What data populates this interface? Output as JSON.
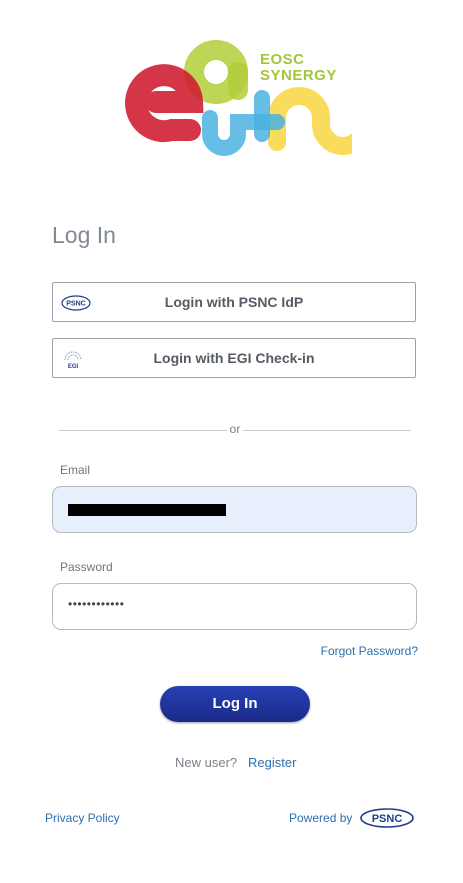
{
  "brand": {
    "line1": "EOSC",
    "line2": "SYNERGY"
  },
  "login": {
    "title": "Log In",
    "idp_buttons": [
      {
        "label": "Login with PSNC IdP",
        "icon": "psnc-icon",
        "icon_text": "PSNC"
      },
      {
        "label": "Login with EGI Check-in",
        "icon": "egi-icon",
        "icon_text": "EGI"
      }
    ],
    "divider_text": "or",
    "email_label": "Email",
    "password_label": "Password",
    "password_value": "••••••••••••",
    "forgot_password": "Forgot Password?",
    "submit_label": "Log In",
    "new_user_text": "New user?",
    "register_link": "Register"
  },
  "footer": {
    "privacy_policy": "Privacy Policy",
    "powered_by": "Powered by",
    "psnc_logo_text": "PSNC"
  },
  "colors": {
    "red": "#cf2034",
    "green": "#b3cf3a",
    "blue": "#4bb2e0",
    "yellow": "#f9d84b",
    "link": "#2f6fad",
    "button": "#1f34a0"
  }
}
